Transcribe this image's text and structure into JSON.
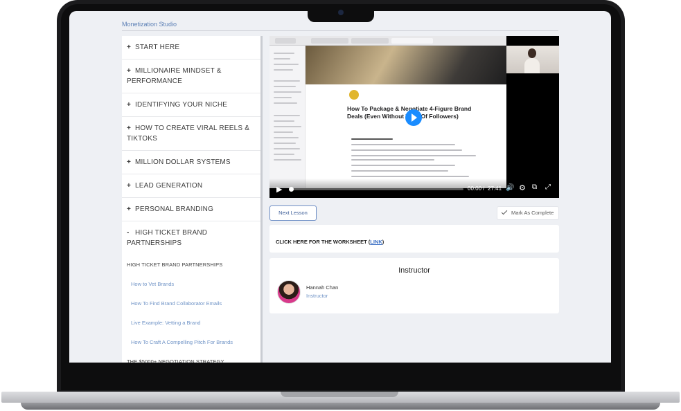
{
  "brand": "Monetization Studio",
  "modules": [
    {
      "sign": "+",
      "title": "START HERE"
    },
    {
      "sign": "+",
      "title": "MILLIONAIRE MINDSET & PERFORMANCE"
    },
    {
      "sign": "+",
      "title": "IDENTIFYING YOUR NICHE"
    },
    {
      "sign": "+",
      "title": "HOW TO CREATE VIRAL REELS & TIKTOKS"
    },
    {
      "sign": "+",
      "title": "MILLION DOLLAR SYSTEMS"
    },
    {
      "sign": "+",
      "title": "LEAD GENERATION"
    },
    {
      "sign": "+",
      "title": "PERSONAL BRANDING"
    },
    {
      "sign": "-",
      "title": "HIGH TICKET BRAND PARTNERSHIPS"
    }
  ],
  "expanded": {
    "section_heading": "HIGH TICKET BRAND PARTNERSHIPS",
    "lessons": [
      "How to Vet Brands",
      "How To Find Brand Collaborator Emails",
      "Live Example: Vetting a Brand",
      "How To Craft A Compelling Pitch For Brands"
    ],
    "next_section": "THE $5000+ NEGOTIATION STRATEGY"
  },
  "video": {
    "slide_title": "How To Package & Negotiate 4-Figure Brand Deals (Even Without Tons Of Followers)",
    "current_time": "00:00",
    "separator": "/",
    "duration": "27:41",
    "progress": 0.0
  },
  "actions": {
    "next_lesson": "Next Lesson",
    "mark_complete": "Mark As Complete"
  },
  "worksheet": {
    "text": "CLICK HERE FOR THE WORKSHEET (",
    "link": "LINK",
    "close": ")"
  },
  "instructor": {
    "heading": "Instructor",
    "name": "Hannah Chan",
    "role": "Instructor"
  },
  "colors": {
    "accent": "#6f93c6",
    "link": "#3b6fc4",
    "play": "#1a8cff"
  }
}
